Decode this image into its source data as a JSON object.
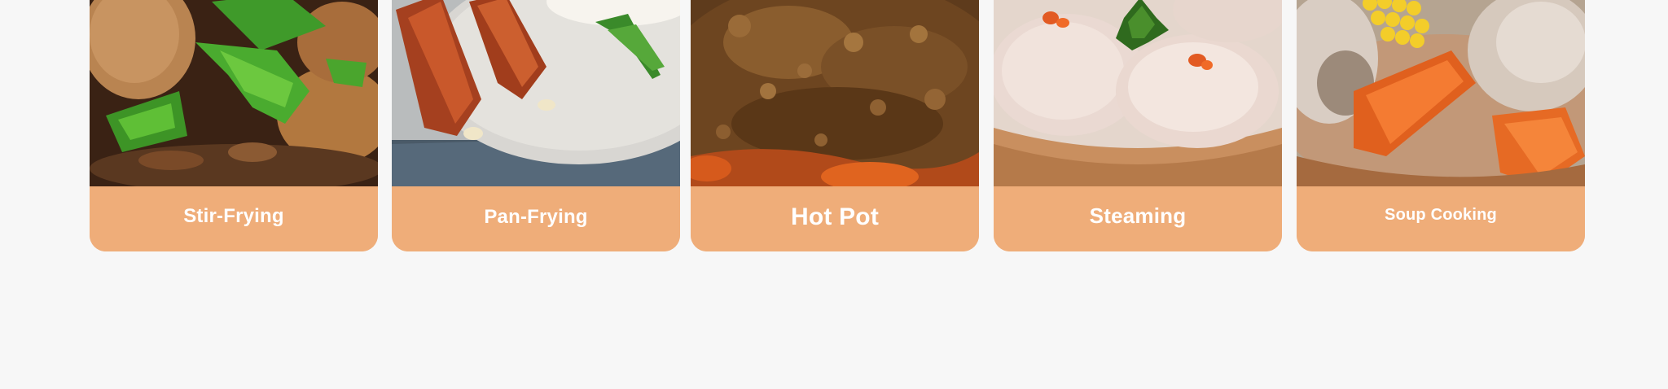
{
  "theme": {
    "background": "#f7f7f7",
    "card_label_background": "#efad79",
    "label_text_color": "#ffffff"
  },
  "cooking_modes": [
    {
      "id": "stir-frying",
      "label": "Stir-Frying",
      "image": "stir-fry-green-peppers-image"
    },
    {
      "id": "pan-frying",
      "label": "Pan-Frying",
      "image": "pan-fried-sausages-image"
    },
    {
      "id": "hot-pot",
      "label": "Hot Pot",
      "image": "bubbling-hot-pot-image"
    },
    {
      "id": "steaming",
      "label": "Steaming",
      "image": "steamed-shrimp-dumplings-image"
    },
    {
      "id": "soup-cooking",
      "label": "Soup Cooking",
      "image": "corn-carrot-pork-soup-image"
    }
  ]
}
